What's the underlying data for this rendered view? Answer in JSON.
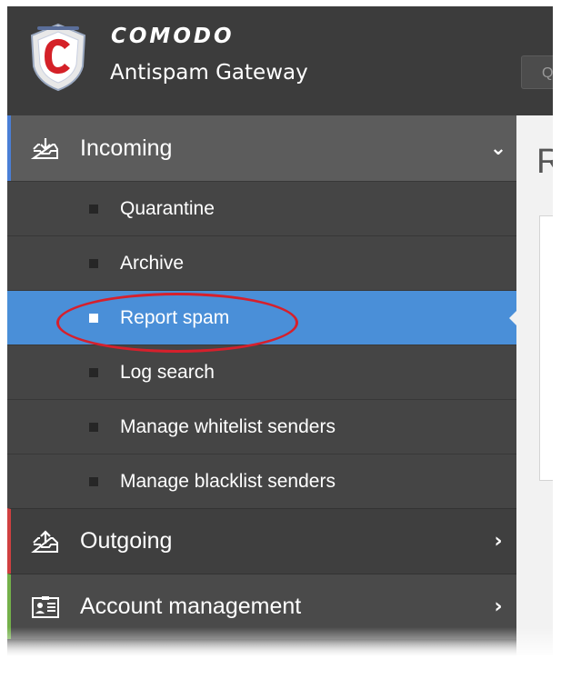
{
  "header": {
    "brand": "COMODO",
    "product": "Antispam Gateway",
    "search_partial": "Q"
  },
  "sidebar": {
    "incoming": {
      "label": "Incoming",
      "items": [
        {
          "label": "Quarantine"
        },
        {
          "label": "Archive"
        },
        {
          "label": "Report spam",
          "active": true
        },
        {
          "label": "Log search"
        },
        {
          "label": "Manage whitelist senders"
        },
        {
          "label": "Manage blacklist senders"
        }
      ]
    },
    "outgoing": {
      "label": "Outgoing"
    },
    "account": {
      "label": "Account management"
    }
  },
  "content": {
    "title_partial": "R"
  },
  "colors": {
    "active_item": "#4a8fd8",
    "incoming_accent": "#4a7fd6",
    "outgoing_accent": "#d04040",
    "account_accent": "#74b04a",
    "annotation": "#d6202c"
  }
}
